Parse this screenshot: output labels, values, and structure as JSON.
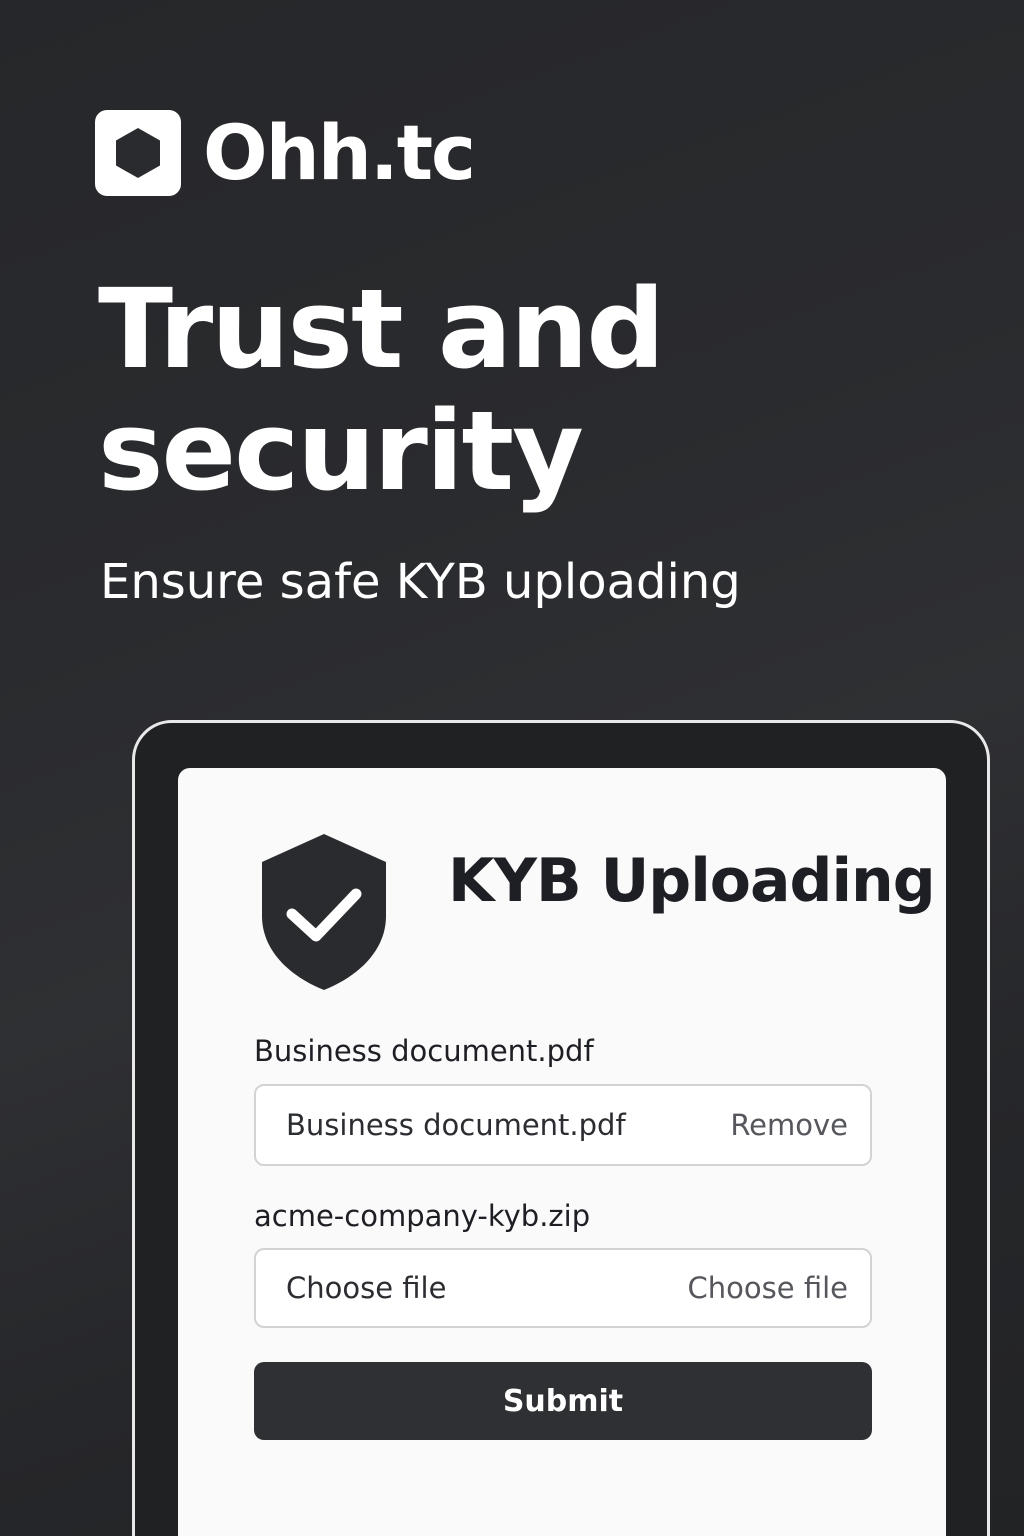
{
  "brand": {
    "name": "Ohh.tc",
    "logo_icon": "hexagon-icon"
  },
  "hero": {
    "title": "Trust and security",
    "subtitle": "Ensure safe KYB uploading"
  },
  "card": {
    "icon": "shield-check-icon",
    "title": "KYB Uploading",
    "fields": [
      {
        "label": "Business document.pdf",
        "value": "Business document.pdf",
        "action": "Remove"
      },
      {
        "label": "acme-company-kyb.zip",
        "value": "Choose file",
        "action": "Choose file"
      }
    ],
    "submit_label": "Submit"
  },
  "colors": {
    "background": "#2a2b2e",
    "card": "#fafafa",
    "button": "#2f3033",
    "text_dark": "#1d1f24"
  }
}
